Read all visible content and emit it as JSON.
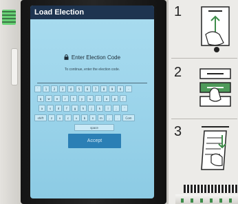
{
  "screen": {
    "title": "Load Election",
    "heading": "Enter Election Code",
    "subtitle": "To continue, enter the election code.",
    "code_value": "",
    "accept_label": "Accept"
  },
  "keyboard": {
    "row1": [
      "`",
      "1",
      "2",
      "3",
      "4",
      "5",
      "6",
      "7",
      "8",
      "9",
      "0",
      "-"
    ],
    "row2": [
      "q",
      "w",
      "e",
      "r",
      "t",
      "y",
      "u",
      "i",
      "o",
      "p",
      "["
    ],
    "row3": [
      "a",
      "s",
      "d",
      "f",
      "g",
      "h",
      "j",
      "k",
      "l",
      ";",
      "'"
    ],
    "row4": [
      "shift",
      "z",
      "x",
      "c",
      "v",
      "b",
      "n",
      "m",
      ",",
      ".",
      "Com"
    ],
    "space_label": "space"
  },
  "instructions": {
    "step1": "1",
    "step2": "2",
    "step3": "3"
  },
  "colors": {
    "titlebar": "#1e3450",
    "screen": "#a9dcef",
    "accept": "#2b7fb5",
    "led": "#5ad06a"
  }
}
